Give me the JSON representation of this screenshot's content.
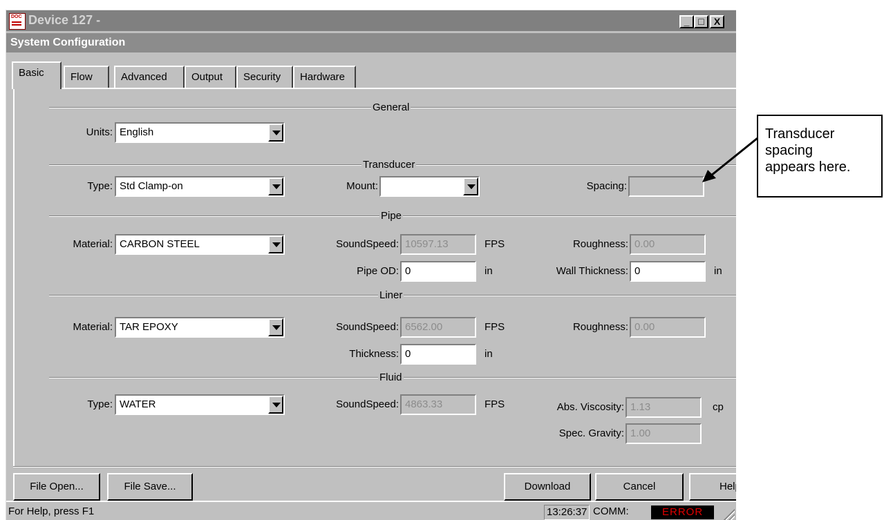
{
  "window": {
    "title": "Device 127 -",
    "subtitle": "System Configuration",
    "caption_buttons": [
      "_",
      "□",
      "X"
    ]
  },
  "tabs": [
    {
      "label": "Basic",
      "active": true
    },
    {
      "label": "Flow"
    },
    {
      "label": "Advanced"
    },
    {
      "label": "Output"
    },
    {
      "label": "Security"
    },
    {
      "label": "Hardware"
    }
  ],
  "general": {
    "group_label": "General",
    "units_label": "Units:",
    "units_value": "English"
  },
  "transducer": {
    "group_label": "Transducer",
    "type_label": "Type:",
    "type_value": "Std Clamp-on",
    "mount_label": "Mount:",
    "mount_value": "",
    "spacing_label": "Spacing:",
    "spacing_value": ""
  },
  "pipe": {
    "group_label": "Pipe",
    "material_label": "Material:",
    "material_value": "CARBON STEEL",
    "soundspeed_label": "SoundSpeed:",
    "soundspeed_value": "10597.13",
    "soundspeed_unit": "FPS",
    "roughness_label": "Roughness:",
    "roughness_value": "0.00",
    "od_label": "Pipe OD:",
    "od_value": "0",
    "od_unit": "in",
    "wall_label": "Wall Thickness:",
    "wall_value": "0",
    "wall_unit": "in"
  },
  "liner": {
    "group_label": "Liner",
    "material_label": "Material:",
    "material_value": "TAR EPOXY",
    "soundspeed_label": "SoundSpeed:",
    "soundspeed_value": "6562.00",
    "soundspeed_unit": "FPS",
    "roughness_label": "Roughness:",
    "roughness_value": "0.00",
    "thickness_label": "Thickness:",
    "thickness_value": "0",
    "thickness_unit": "in"
  },
  "fluid": {
    "group_label": "Fluid",
    "type_label": "Type:",
    "type_value": "WATER",
    "soundspeed_label": "SoundSpeed:",
    "soundspeed_value": "4863.33",
    "soundspeed_unit": "FPS",
    "viscosity_label": "Abs. Viscosity:",
    "viscosity_value": "1.13",
    "viscosity_unit": "cp",
    "gravity_label": "Spec. Gravity:",
    "gravity_value": "1.00"
  },
  "buttons": {
    "file_open": "File Open...",
    "file_save": "File Save...",
    "download": "Download",
    "cancel": "Cancel",
    "help": "Help"
  },
  "status": {
    "help_text": "For Help, press F1",
    "time": "13:26:37",
    "comm_label": "COMM:",
    "comm_status": "ERROR",
    "error_color": "#e00000"
  },
  "callout": {
    "text": "Transducer\nspacing\nappears here."
  }
}
